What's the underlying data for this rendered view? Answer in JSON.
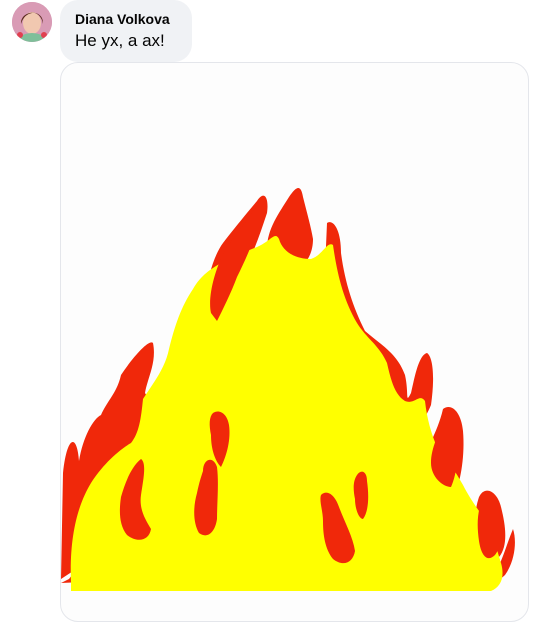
{
  "comment": {
    "author": "Diana Volkova",
    "text": "Не ух, а ах!",
    "avatar_icon": "profile-avatar"
  },
  "attachment": {
    "type": "image",
    "depicts": "drawing-fire-icon",
    "colors": {
      "flame_outer": "#f0280a",
      "flame_inner": "#ffff00",
      "background": "#fdfdfd"
    }
  }
}
